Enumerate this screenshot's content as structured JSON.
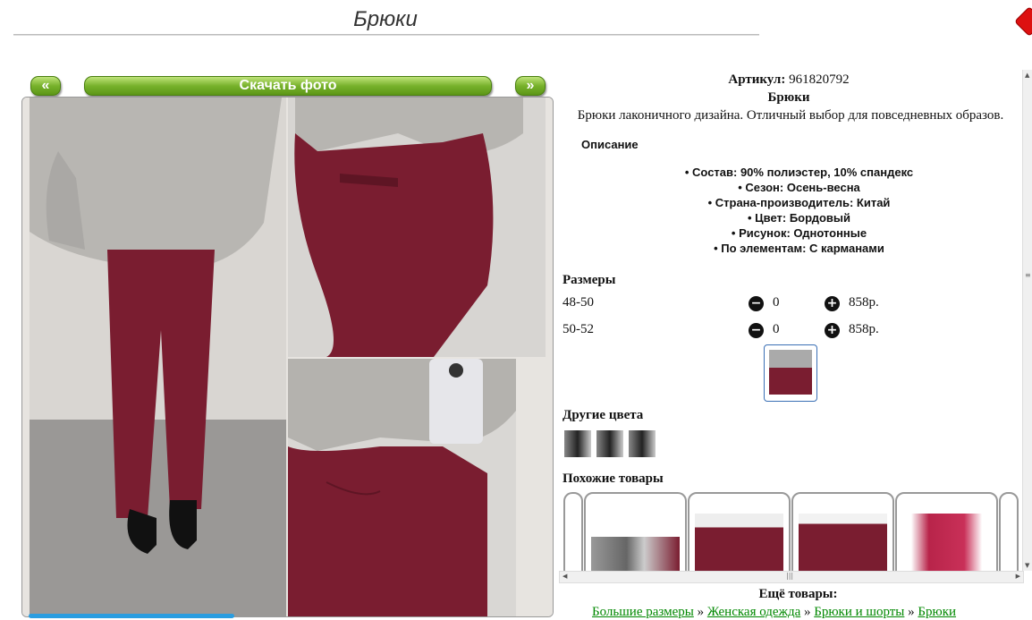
{
  "page": {
    "title": "Брюки"
  },
  "nav": {
    "prev_label": "«",
    "download_label": "Скачать фото",
    "next_label": "»"
  },
  "product": {
    "sku_label": "Артикул:",
    "sku_value": "961820792",
    "name": "Брюки",
    "description": "Брюки лаконичного дизайна. Отличный выбор для повседневных образов.",
    "desc_heading": "Описание",
    "properties": [
      "Состав: 90% полиэстер, 10% спандекс",
      "Сезон: Осень-весна",
      "Страна-производитель: Китай",
      "Цвет: Бордовый",
      "Рисунок: Однотонные",
      "По элементам: С карманами"
    ]
  },
  "sizes": {
    "heading": "Размеры",
    "rows": [
      {
        "size": "48-50",
        "qty": "0",
        "price": "858р."
      },
      {
        "size": "50-52",
        "qty": "0",
        "price": "858р."
      }
    ]
  },
  "colors": {
    "heading": "Другие цвета"
  },
  "similar": {
    "heading": "Похожие товары"
  },
  "more": {
    "heading": "Ещё товары:",
    "breadcrumbs": [
      "Большие размеры",
      "Женская одежда",
      "Брюки и шорты",
      "Брюки"
    ],
    "separator": "»"
  },
  "icons": {
    "prev": "chevron-left-icon",
    "next": "chevron-right-icon",
    "minus": "minus-circle-icon",
    "plus": "plus-circle-icon",
    "close": "close-icon"
  },
  "colors_theme": {
    "button_green": "#77b22b",
    "link_green": "#008800",
    "product_burgundy": "#7a1d30"
  }
}
